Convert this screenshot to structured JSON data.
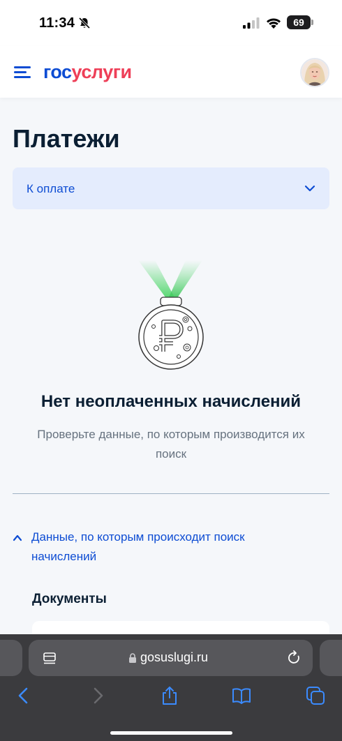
{
  "status_bar": {
    "time": "11:34",
    "battery": "69",
    "icons": [
      "bell-slash-icon",
      "signal-icon",
      "wifi-icon",
      "battery-icon"
    ]
  },
  "header": {
    "logo_part1": "гос",
    "logo_part2": "услуги",
    "icons": [
      "menu-icon",
      "avatar"
    ]
  },
  "page": {
    "title": "Платежи",
    "filter": {
      "selected": "К оплате",
      "icon": "chevron-down-icon"
    },
    "empty_state": {
      "title": "Нет неоплаченных начислений",
      "description": "Проверьте данные, по которым производится их поиск"
    },
    "search_data_toggle": {
      "label": "Данные, по которым происходит поиск начислений",
      "icon": "chevron-up-icon"
    },
    "documents_heading": "Документы"
  },
  "browser": {
    "url": "gosuslugi.ru",
    "icons": [
      "page-menu-icon",
      "lock-icon",
      "reload-icon",
      "back-icon",
      "forward-icon",
      "share-icon",
      "bookmarks-icon",
      "tabs-icon"
    ]
  },
  "colors": {
    "brand_blue": "#0d4cd3",
    "brand_red": "#ee3f58",
    "filter_bg": "#e4ecfd",
    "text_dark": "#0b1f33",
    "text_muted": "#66727f",
    "browser_bar": "#3b3b3e",
    "medal_ribbon": "#4fd66a"
  }
}
